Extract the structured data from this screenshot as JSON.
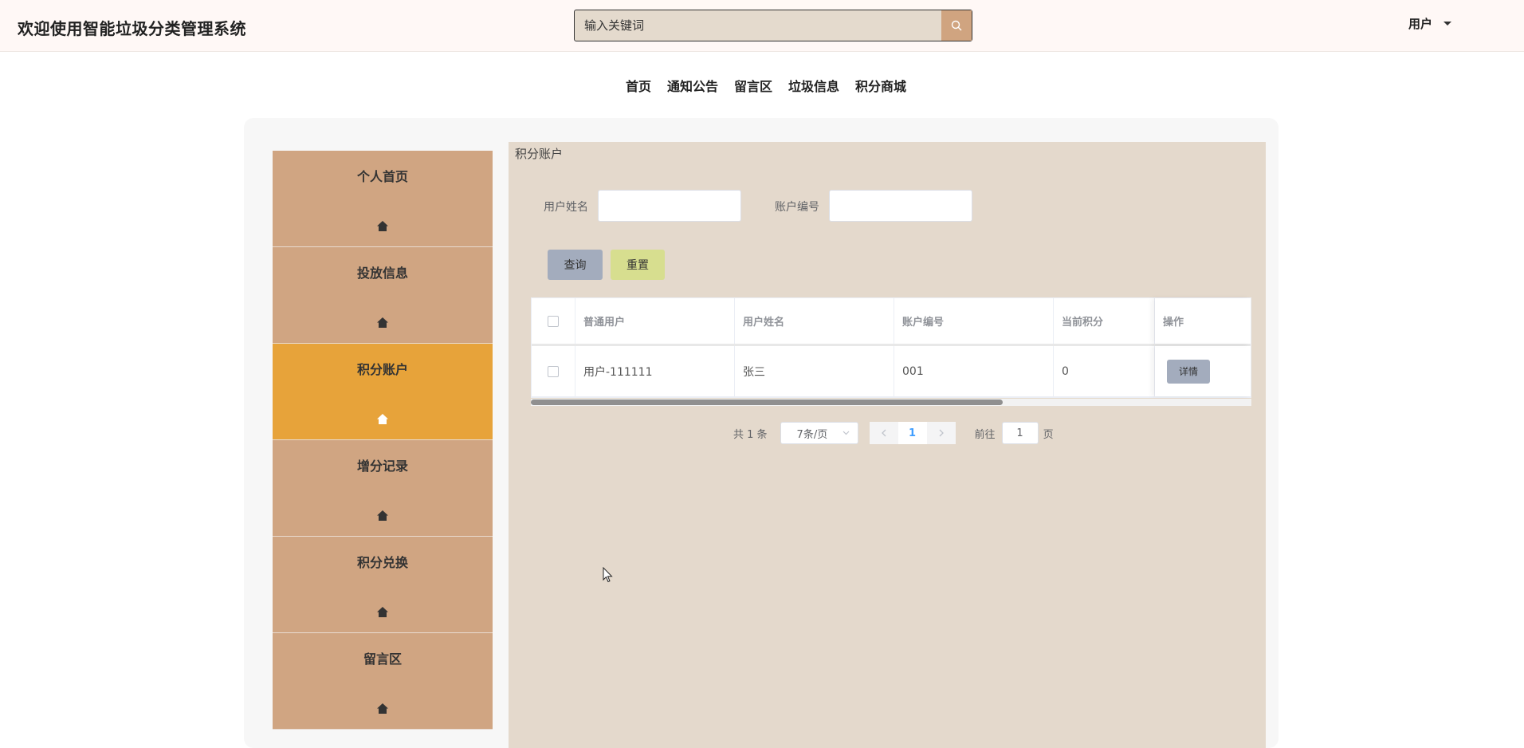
{
  "header": {
    "title": "欢迎使用智能垃圾分类管理系统",
    "search_placeholder": "输入关键词",
    "user_label": "用户"
  },
  "nav": {
    "items": [
      "首页",
      "通知公告",
      "留言区",
      "垃圾信息",
      "积分商城"
    ]
  },
  "sidebar": {
    "items": [
      {
        "label": "个人首页",
        "icon": "home-icon"
      },
      {
        "label": "投放信息",
        "icon": "home-icon"
      },
      {
        "label": "积分账户",
        "icon": "home-icon",
        "active": true
      },
      {
        "label": "增分记录",
        "icon": "home-icon"
      },
      {
        "label": "积分兑换",
        "icon": "home-icon"
      },
      {
        "label": "留言区",
        "icon": "home-icon"
      }
    ]
  },
  "main": {
    "title": "积分账户",
    "form": {
      "name_label": "用户姓名",
      "name_value": "",
      "account_label": "账户编号",
      "account_value": ""
    },
    "buttons": {
      "query": "查询",
      "reset": "重置"
    },
    "table": {
      "columns": [
        "普通用户",
        "用户姓名",
        "账户编号",
        "当前积分",
        "操作"
      ],
      "rows": [
        {
          "user": "用户-111111",
          "name": "张三",
          "account": "001",
          "points": "0",
          "action": "详情"
        }
      ]
    },
    "pagination": {
      "total": "共 1 条",
      "page_size": "7条/页",
      "current_page": "1",
      "goto_prefix": "前往",
      "goto_value": "1",
      "goto_suffix": "页"
    }
  },
  "colors": {
    "sidebar_bg": "#d0a582",
    "sidebar_active": "#e7a33a",
    "main_bg": "#e4d9cc",
    "search_btn": "#d0a480",
    "query_btn": "#a3acbd",
    "reset_btn": "#d7de8f"
  }
}
